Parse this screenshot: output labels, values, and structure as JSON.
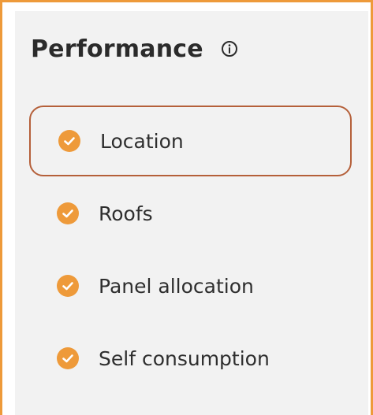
{
  "panel": {
    "title": "Performance",
    "info_icon": "info-circle-icon",
    "accent_color": "#EE9A3A",
    "active_border_color": "#B5603A",
    "steps": [
      {
        "label": "Location",
        "icon": "check-circle-icon",
        "active": true,
        "completed": true
      },
      {
        "label": "Roofs",
        "icon": "check-circle-icon",
        "active": false,
        "completed": true
      },
      {
        "label": "Panel allocation",
        "icon": "check-circle-icon",
        "active": false,
        "completed": true
      },
      {
        "label": "Self consumption",
        "icon": "check-circle-icon",
        "active": false,
        "completed": true
      }
    ]
  }
}
